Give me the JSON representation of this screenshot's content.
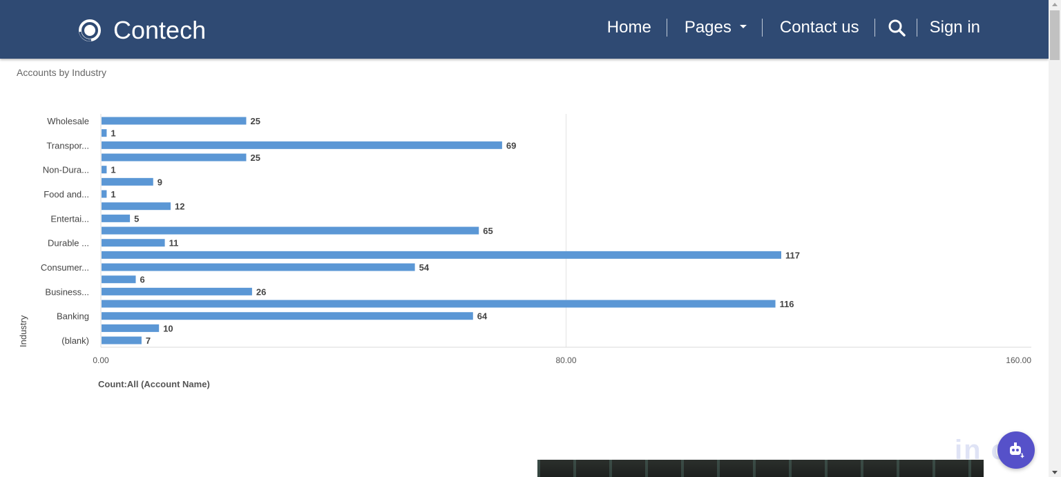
{
  "brand": {
    "name": "Contech",
    "logo_icon": "ring-logo-icon"
  },
  "nav": {
    "home": "Home",
    "pages": "Pages",
    "contact": "Contact us",
    "search_icon": "search-icon",
    "signin": "Sign in"
  },
  "colors": {
    "navbar": "#2f4a73",
    "bar": "#5b97d5",
    "bot_button": "#5651c9"
  },
  "chart_title": "Accounts by Industry",
  "watermark": "in    c",
  "chart_data": {
    "type": "bar",
    "orientation": "horizontal",
    "ylabel": "Industry",
    "xlabel": "Count:All (Account Name)",
    "xlim": [
      0,
      160
    ],
    "xticks": [
      "0.00",
      "80.00",
      "160.00"
    ],
    "categories": [
      "Wholesale",
      "",
      "Transpor...",
      "",
      "Non-Dura...",
      "",
      "Food and...",
      "",
      "Entertai...",
      "",
      "Durable ...",
      "",
      "Consumer...",
      "",
      "Business...",
      "",
      "Banking",
      "",
      "(blank)"
    ],
    "values": [
      25,
      1,
      69,
      25,
      1,
      9,
      1,
      12,
      5,
      65,
      11,
      117,
      54,
      6,
      26,
      116,
      64,
      10,
      7
    ],
    "data_labels": true,
    "grid": "vertical at 80",
    "legend": "none"
  }
}
